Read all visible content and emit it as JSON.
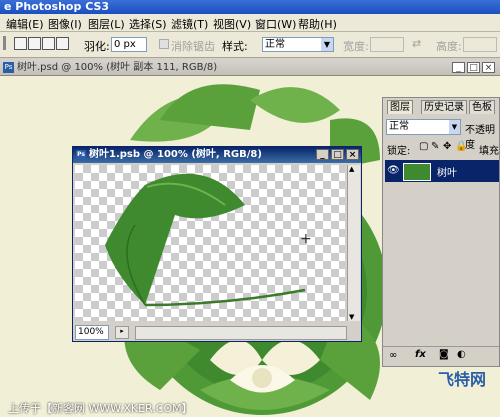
{
  "app": {
    "title": "e Photoshop CS3"
  },
  "menu": [
    "编辑(E)",
    "图像(I)",
    "图层(L)",
    "选择(S)",
    "滤镜(T)",
    "视图(V)",
    "窗口(W)",
    "帮助(H)"
  ],
  "options": {
    "feather_label": "羽化:",
    "feather_value": "0 px",
    "antialias_label": "消除锯齿",
    "style_label": "样式:",
    "style_value": "正常",
    "width_label": "宽度:",
    "height_label": "高度:"
  },
  "document": {
    "tab_title": "树叶.psd @ 100% (树叶 副本 111, RGB/8)"
  },
  "float_window": {
    "title": "树叶1.psb @ 100% (树叶, RGB/8)",
    "zoom": "100%"
  },
  "layers_panel": {
    "tabs": [
      "图层",
      "历史记录",
      "色板"
    ],
    "blend_mode": "正常",
    "opacity_label": "不透明度",
    "lock_label": "锁定:",
    "fill_label": "填充",
    "layer_name": "树叶"
  },
  "watermark": {
    "left_text": "上传于【新客网 WWW.XKER.COM】",
    "right_logo": "飞特网"
  },
  "colors": {
    "leaf": "#3f8a2e",
    "leaf_light": "#6fb14a",
    "canvas_bg": "#f1efd6",
    "selection": "#0a246a"
  }
}
